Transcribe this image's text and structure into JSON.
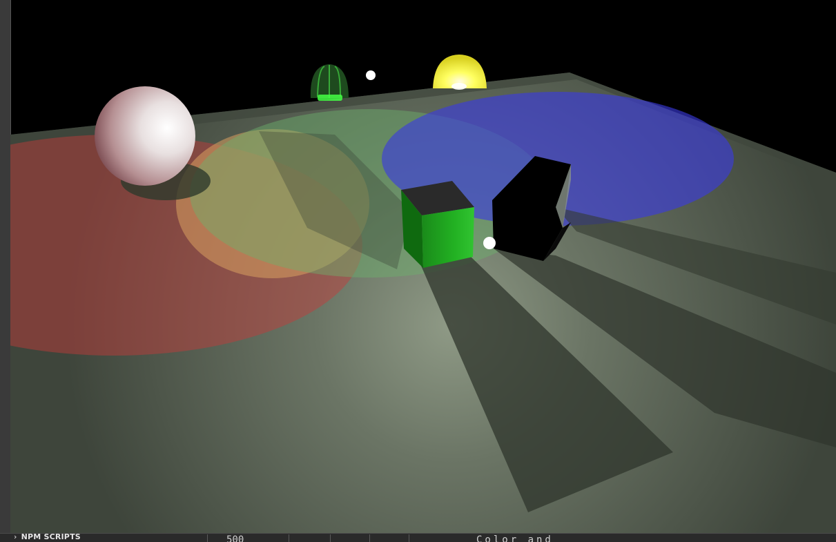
{
  "sidebar": {
    "section_label": "NPM SCRIPTS",
    "chevron_icon": "chevron-right-icon"
  },
  "scene": {
    "background": "#000000",
    "floor_color": "#5c6458",
    "spotlight_colors": {
      "red": "#c83a3a",
      "orange": "#d8a060",
      "green": "#6db26d",
      "blue": "#3a3ae0"
    },
    "objects": [
      "white-sphere",
      "green-hemisphere",
      "yellow-hemisphere",
      "green-cube",
      "black-cube",
      "small-light-sphere",
      "small-light-sphere"
    ]
  },
  "statusbar": {
    "cell_number": "500",
    "cell_text": "Color and"
  }
}
